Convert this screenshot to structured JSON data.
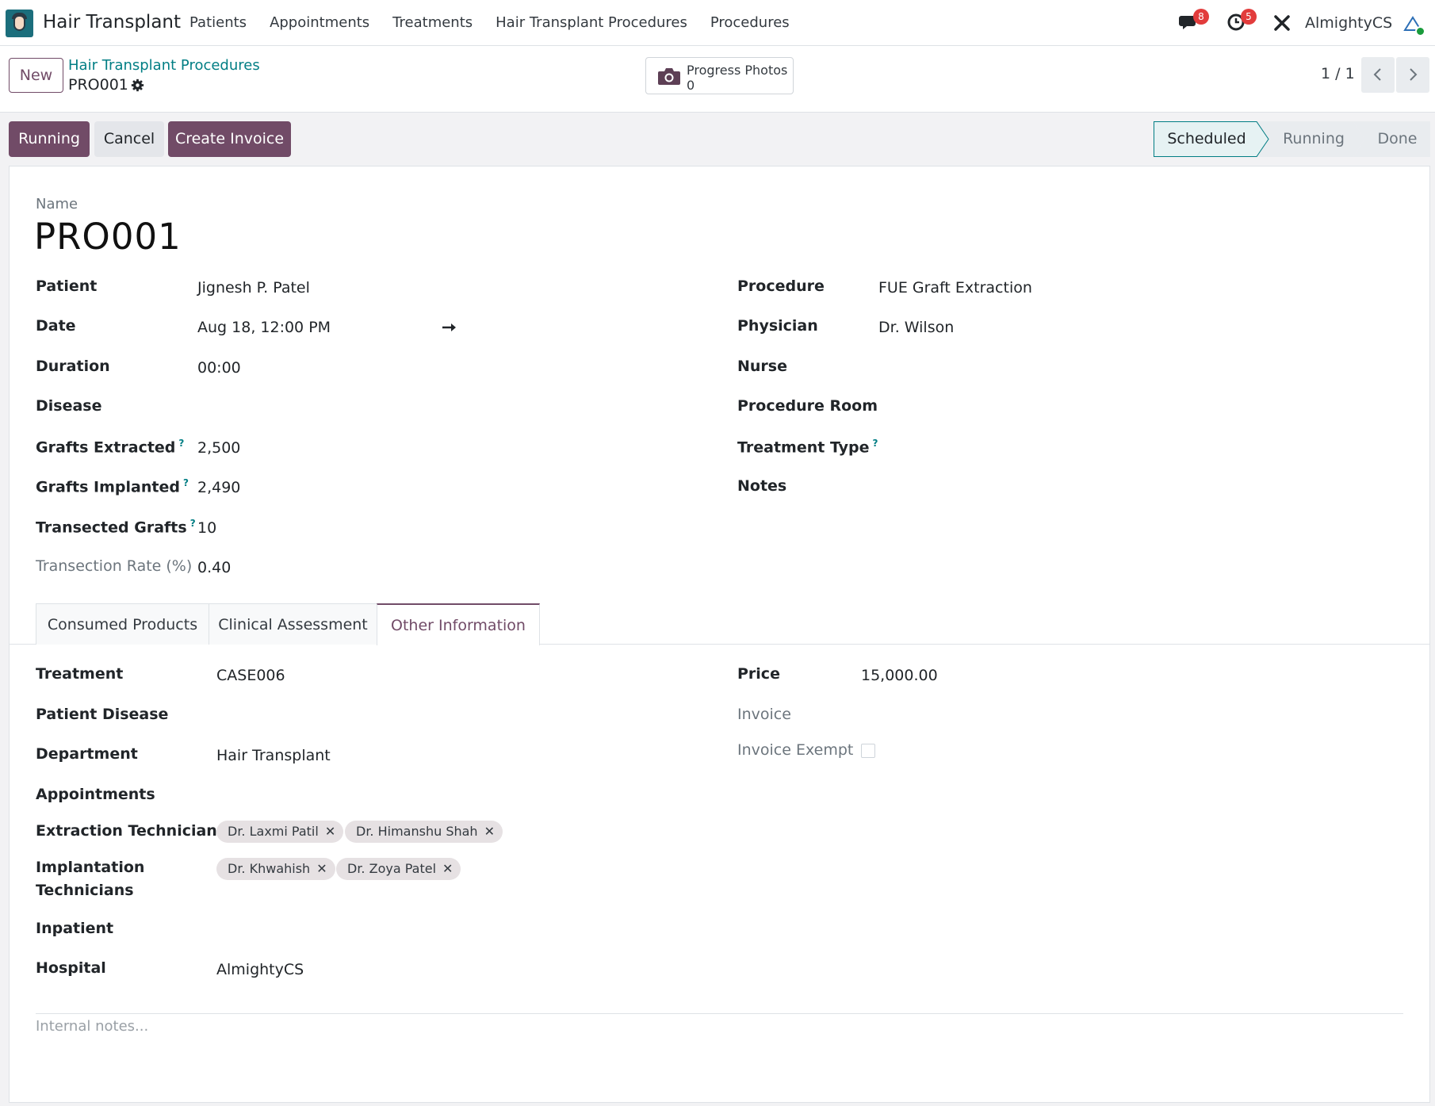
{
  "app": {
    "name": "Hair Transplant",
    "menu": [
      "Patients",
      "Appointments",
      "Treatments",
      "Hair Transplant Procedures",
      "Procedures"
    ],
    "messages_count": "8",
    "activities_count": "5",
    "company": "AlmightyCS"
  },
  "control": {
    "new_label": "New",
    "breadcrumb": "Hair Transplant Procedures",
    "record": "PRO001",
    "smart_button": {
      "label": "Progress Photos",
      "value": "0"
    },
    "pager": "1 / 1"
  },
  "statusbar": {
    "buttons": [
      "Running",
      "Cancel",
      "Create Invoice"
    ],
    "stages": [
      "Scheduled",
      "Running",
      "Done"
    ],
    "active_stage": "Scheduled"
  },
  "form": {
    "name_label": "Name",
    "name_value": "PRO001",
    "left": [
      {
        "label": "Patient",
        "value": "Jignesh P. Patel"
      },
      {
        "label": "Date",
        "value": "Aug 18, 12:00 PM"
      },
      {
        "label": "Duration",
        "value": "00:00"
      },
      {
        "label": "Disease",
        "value": ""
      },
      {
        "label": "Grafts Extracted",
        "value": "2,500",
        "help": "?"
      },
      {
        "label": "Grafts Implanted",
        "value": "2,490",
        "help": "?"
      },
      {
        "label": "Transected Grafts",
        "value": "10",
        "help": "?"
      },
      {
        "label": "Transection Rate (%)",
        "value": "0.40"
      }
    ],
    "right": [
      {
        "label": "Procedure",
        "value": "FUE Graft Extraction"
      },
      {
        "label": "Physician",
        "value": "Dr. Wilson"
      },
      {
        "label": "Nurse",
        "value": ""
      },
      {
        "label": "Procedure Room",
        "value": ""
      },
      {
        "label": "Treatment Type",
        "value": "",
        "help": "?"
      },
      {
        "label": "Notes",
        "value": ""
      }
    ]
  },
  "tabs": [
    "Consumed Products",
    "Clinical Assessment",
    "Other Information"
  ],
  "active_tab": "Other Information",
  "other_info": {
    "left": [
      {
        "label": "Treatment",
        "value": "CASE006"
      },
      {
        "label": "Patient Disease",
        "value": ""
      },
      {
        "label": "Department",
        "value": "Hair Transplant"
      },
      {
        "label": "Appointments",
        "value": ""
      },
      {
        "label": "Extraction Technicians",
        "tags": [
          "Dr. Laxmi Patil",
          "Dr. Himanshu Shah"
        ]
      },
      {
        "label_line1": "Implantation",
        "label_line2": "Technicians",
        "tags": [
          "Dr. Khwahish",
          "Dr. Zoya Patel"
        ]
      },
      {
        "label": "Inpatient",
        "value": ""
      },
      {
        "label": "Hospital",
        "value": "AlmightyCS"
      }
    ],
    "right": [
      {
        "label": "Price",
        "value": "15,000.00"
      },
      {
        "label": "Invoice",
        "value": ""
      },
      {
        "label": "Invoice Exempt",
        "checked": false
      }
    ]
  },
  "notes_placeholder": "Internal notes...",
  "colors": {
    "primary": "#714b67",
    "link": "#017e84",
    "badge": "#e23c3c",
    "stage_active_bg": "#e6f2f3"
  },
  "icons": [
    "app-logo",
    "chat-icon",
    "clock-icon",
    "tools-icon",
    "gear-icon",
    "camera-icon",
    "chevron-left-icon",
    "chevron-right-icon",
    "arrow-right-icon",
    "close-icon"
  ]
}
